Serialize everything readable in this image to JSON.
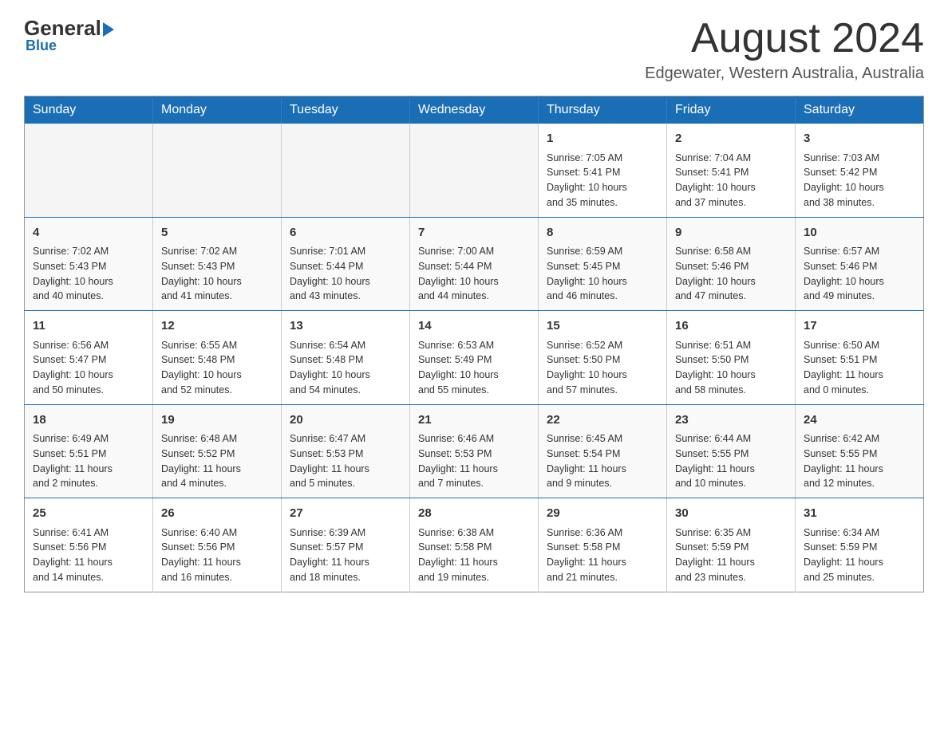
{
  "logo": {
    "text_general": "General",
    "text_blue": "Blue",
    "subtitle": "Blue"
  },
  "title": "August 2024",
  "location": "Edgewater, Western Australia, Australia",
  "days_of_week": [
    "Sunday",
    "Monday",
    "Tuesday",
    "Wednesday",
    "Thursday",
    "Friday",
    "Saturday"
  ],
  "weeks": [
    [
      {
        "day": "",
        "info": ""
      },
      {
        "day": "",
        "info": ""
      },
      {
        "day": "",
        "info": ""
      },
      {
        "day": "",
        "info": ""
      },
      {
        "day": "1",
        "info": "Sunrise: 7:05 AM\nSunset: 5:41 PM\nDaylight: 10 hours\nand 35 minutes."
      },
      {
        "day": "2",
        "info": "Sunrise: 7:04 AM\nSunset: 5:41 PM\nDaylight: 10 hours\nand 37 minutes."
      },
      {
        "day": "3",
        "info": "Sunrise: 7:03 AM\nSunset: 5:42 PM\nDaylight: 10 hours\nand 38 minutes."
      }
    ],
    [
      {
        "day": "4",
        "info": "Sunrise: 7:02 AM\nSunset: 5:43 PM\nDaylight: 10 hours\nand 40 minutes."
      },
      {
        "day": "5",
        "info": "Sunrise: 7:02 AM\nSunset: 5:43 PM\nDaylight: 10 hours\nand 41 minutes."
      },
      {
        "day": "6",
        "info": "Sunrise: 7:01 AM\nSunset: 5:44 PM\nDaylight: 10 hours\nand 43 minutes."
      },
      {
        "day": "7",
        "info": "Sunrise: 7:00 AM\nSunset: 5:44 PM\nDaylight: 10 hours\nand 44 minutes."
      },
      {
        "day": "8",
        "info": "Sunrise: 6:59 AM\nSunset: 5:45 PM\nDaylight: 10 hours\nand 46 minutes."
      },
      {
        "day": "9",
        "info": "Sunrise: 6:58 AM\nSunset: 5:46 PM\nDaylight: 10 hours\nand 47 minutes."
      },
      {
        "day": "10",
        "info": "Sunrise: 6:57 AM\nSunset: 5:46 PM\nDaylight: 10 hours\nand 49 minutes."
      }
    ],
    [
      {
        "day": "11",
        "info": "Sunrise: 6:56 AM\nSunset: 5:47 PM\nDaylight: 10 hours\nand 50 minutes."
      },
      {
        "day": "12",
        "info": "Sunrise: 6:55 AM\nSunset: 5:48 PM\nDaylight: 10 hours\nand 52 minutes."
      },
      {
        "day": "13",
        "info": "Sunrise: 6:54 AM\nSunset: 5:48 PM\nDaylight: 10 hours\nand 54 minutes."
      },
      {
        "day": "14",
        "info": "Sunrise: 6:53 AM\nSunset: 5:49 PM\nDaylight: 10 hours\nand 55 minutes."
      },
      {
        "day": "15",
        "info": "Sunrise: 6:52 AM\nSunset: 5:50 PM\nDaylight: 10 hours\nand 57 minutes."
      },
      {
        "day": "16",
        "info": "Sunrise: 6:51 AM\nSunset: 5:50 PM\nDaylight: 10 hours\nand 58 minutes."
      },
      {
        "day": "17",
        "info": "Sunrise: 6:50 AM\nSunset: 5:51 PM\nDaylight: 11 hours\nand 0 minutes."
      }
    ],
    [
      {
        "day": "18",
        "info": "Sunrise: 6:49 AM\nSunset: 5:51 PM\nDaylight: 11 hours\nand 2 minutes."
      },
      {
        "day": "19",
        "info": "Sunrise: 6:48 AM\nSunset: 5:52 PM\nDaylight: 11 hours\nand 4 minutes."
      },
      {
        "day": "20",
        "info": "Sunrise: 6:47 AM\nSunset: 5:53 PM\nDaylight: 11 hours\nand 5 minutes."
      },
      {
        "day": "21",
        "info": "Sunrise: 6:46 AM\nSunset: 5:53 PM\nDaylight: 11 hours\nand 7 minutes."
      },
      {
        "day": "22",
        "info": "Sunrise: 6:45 AM\nSunset: 5:54 PM\nDaylight: 11 hours\nand 9 minutes."
      },
      {
        "day": "23",
        "info": "Sunrise: 6:44 AM\nSunset: 5:55 PM\nDaylight: 11 hours\nand 10 minutes."
      },
      {
        "day": "24",
        "info": "Sunrise: 6:42 AM\nSunset: 5:55 PM\nDaylight: 11 hours\nand 12 minutes."
      }
    ],
    [
      {
        "day": "25",
        "info": "Sunrise: 6:41 AM\nSunset: 5:56 PM\nDaylight: 11 hours\nand 14 minutes."
      },
      {
        "day": "26",
        "info": "Sunrise: 6:40 AM\nSunset: 5:56 PM\nDaylight: 11 hours\nand 16 minutes."
      },
      {
        "day": "27",
        "info": "Sunrise: 6:39 AM\nSunset: 5:57 PM\nDaylight: 11 hours\nand 18 minutes."
      },
      {
        "day": "28",
        "info": "Sunrise: 6:38 AM\nSunset: 5:58 PM\nDaylight: 11 hours\nand 19 minutes."
      },
      {
        "day": "29",
        "info": "Sunrise: 6:36 AM\nSunset: 5:58 PM\nDaylight: 11 hours\nand 21 minutes."
      },
      {
        "day": "30",
        "info": "Sunrise: 6:35 AM\nSunset: 5:59 PM\nDaylight: 11 hours\nand 23 minutes."
      },
      {
        "day": "31",
        "info": "Sunrise: 6:34 AM\nSunset: 5:59 PM\nDaylight: 11 hours\nand 25 minutes."
      }
    ]
  ]
}
